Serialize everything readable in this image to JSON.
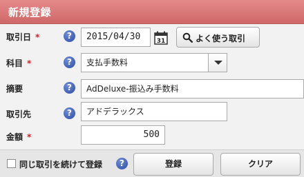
{
  "window": {
    "title": "新規登録"
  },
  "fields": {
    "date": {
      "label": "取引日",
      "required_mark": "*",
      "value": "2015/04/30",
      "calendar_day": "31"
    },
    "account": {
      "label": "科目",
      "required_mark": "*",
      "value": "支払手数料"
    },
    "summary": {
      "label": "摘要",
      "value": "AdDeluxe-振込み手数料"
    },
    "partner": {
      "label": "取引先",
      "value": "アドデラックス"
    },
    "amount": {
      "label": "金額",
      "required_mark": "*",
      "value": "500"
    }
  },
  "help_glyph": "?",
  "buttons": {
    "frequent": "よく使う取引",
    "register": "登録",
    "clear": "クリア"
  },
  "footer": {
    "continue_label": "同じ取引を続けて登録"
  },
  "colors": {
    "header_bg": "#d87676",
    "required": "#cc2222",
    "help_icon": "#2c4da8"
  }
}
